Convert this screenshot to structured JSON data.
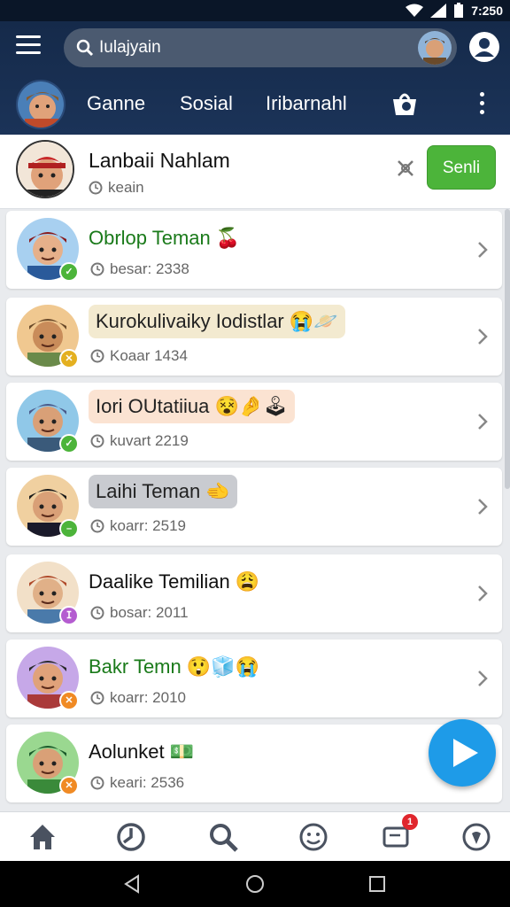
{
  "status_bar": {
    "time": "7:250"
  },
  "header": {
    "search": {
      "value": "Iulajyain"
    },
    "tabs": [
      {
        "label": "Ganne"
      },
      {
        "label": "Sosial"
      },
      {
        "label": "Iribarnahl"
      }
    ]
  },
  "friend_request": {
    "name": "Lanbaii Nahlam",
    "subtitle": "keain",
    "send_label": "Senli"
  },
  "friends": [
    {
      "name": "Obrlop Teman",
      "emoji": "🍒",
      "sub": "besar: 2338",
      "name_color": "#1a7a1a",
      "pill_color": "",
      "badge_color": "#4cb43a",
      "badge_icon": "✓"
    },
    {
      "name": "Kurokulivaiky Iodistlar",
      "emoji": "😭🪐",
      "sub": "Koaar 1434",
      "name_color": "#222222",
      "pill_color": "#f3ead0",
      "badge_color": "#e4b020",
      "badge_icon": "✕"
    },
    {
      "name": "Iori OUtatiiua",
      "emoji": "😵🤌🕹",
      "sub": "kuvart 2219",
      "name_color": "#222222",
      "pill_color": "#fbe3d2",
      "badge_color": "#4cb43a",
      "badge_icon": "✓"
    },
    {
      "name": "Laihi Teman",
      "emoji": "🫲",
      "sub": "koarr: 2519",
      "name_color": "#222222",
      "pill_color": "#c9cbd0",
      "badge_color": "#4cb43a",
      "badge_icon": "–"
    },
    {
      "name": "Daalike Temilian",
      "emoji": "😩",
      "sub": "bosar: 2011",
      "name_color": "#111111",
      "pill_color": "",
      "badge_color": "#b45cd0",
      "badge_icon": "ⵊ"
    },
    {
      "name": "Bakr Temn",
      "emoji": "😲🧊😭",
      "sub": "koarr: 2010",
      "name_color": "#1a7a1a",
      "pill_color": "",
      "badge_color": "#f08a24",
      "badge_icon": "✕"
    },
    {
      "name": "Aolunket",
      "emoji": "💵",
      "sub": "keari: 2536",
      "name_color": "#111111",
      "pill_color": "",
      "badge_color": "#f08a24",
      "badge_icon": "✕"
    }
  ],
  "bottom_nav": {
    "notification_count": "1",
    "items": [
      "home-icon",
      "clock-icon",
      "search-icon",
      "emoji-icon",
      "messages-icon",
      "settings-icon"
    ]
  },
  "colors": {
    "header_bg": "#152a4a",
    "send_button": "#4cb43a",
    "fab": "#1e9be8",
    "notification": "#e0262d"
  }
}
